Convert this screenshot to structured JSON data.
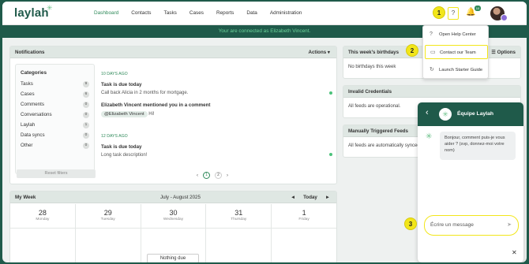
{
  "brand": {
    "logo": "laylah",
    "logo_star": "✳"
  },
  "nav": {
    "items": [
      "Dashboard",
      "Contacts",
      "Tasks",
      "Cases",
      "Reports",
      "Data",
      "Administration"
    ],
    "active": "Dashboard"
  },
  "header_icons": {
    "help": "?",
    "bell": "🔔",
    "bell_badge": "10"
  },
  "markers": {
    "one": "1",
    "two": "2",
    "three": "3"
  },
  "banner": {
    "text": "Your are connected as Elizabeth Vincent."
  },
  "notifications": {
    "title": "Notifications",
    "actions_label": "Actions ▾",
    "categories_title": "Categories",
    "categories": [
      {
        "label": "Tasks",
        "count": "9"
      },
      {
        "label": "Cases",
        "count": "6"
      },
      {
        "label": "Comments",
        "count": "0"
      },
      {
        "label": "Conversations",
        "count": "0"
      },
      {
        "label": "Laylah",
        "count": "1"
      },
      {
        "label": "Data syncs",
        "count": "0"
      },
      {
        "label": "Other",
        "count": "0"
      }
    ],
    "reset_label": "Reset filters",
    "groups": [
      {
        "date": "10 DAYS AGO",
        "items": [
          {
            "title": "Task is due today",
            "body": "Call back Alicia in 2 months for mortgage."
          },
          {
            "title": "Elizabeth Vincent mentioned you in a comment",
            "mention": "@Elizabeth Vincent",
            "body": "Hi!"
          }
        ]
      },
      {
        "date": "12 DAYS AGO",
        "items": [
          {
            "title": "Task is due today",
            "body": "Long task description!"
          }
        ]
      }
    ],
    "pager": {
      "prev": "‹",
      "page1": "1",
      "page2": "2",
      "next": "›"
    }
  },
  "my_week": {
    "title": "My Week",
    "range": "July - August 2025",
    "prev": "◄",
    "today": "Today",
    "next": "►",
    "days": [
      {
        "num": "28",
        "name": "Monday"
      },
      {
        "num": "29",
        "name": "Tuesday"
      },
      {
        "num": "30",
        "name": "Wednesday"
      },
      {
        "num": "31",
        "name": "Thursday"
      },
      {
        "num": "1",
        "name": "Friday"
      }
    ],
    "nothing_due": "Nothing due"
  },
  "birthdays": {
    "title": "This week's birthdays",
    "options": "☰ Options",
    "text": "No birthdays this week"
  },
  "invalid": {
    "title": "Invalid Credentials",
    "text": "All feeds are operational."
  },
  "manual": {
    "title": "Manually Triggered Feeds",
    "text": "All feeds are automatically synced."
  },
  "help_menu": {
    "items": [
      {
        "icon": "?",
        "label": "Open Help Center"
      },
      {
        "icon": "▭",
        "label": "Contact our Team"
      },
      {
        "icon": "↻",
        "label": "Launch Starter Guide"
      }
    ]
  },
  "chat": {
    "back": "‹",
    "title": "Équipe Laylah",
    "message": "Bonjour, comment puis-je vous aider ? (svp, donnez-moi votre nom)",
    "input_placeholder": "Écrire un message",
    "send": "➤",
    "close": "✕"
  },
  "colors": {
    "primary": "#1f5a4a",
    "accent": "#2f8a5a",
    "highlight": "#f2e61a"
  }
}
